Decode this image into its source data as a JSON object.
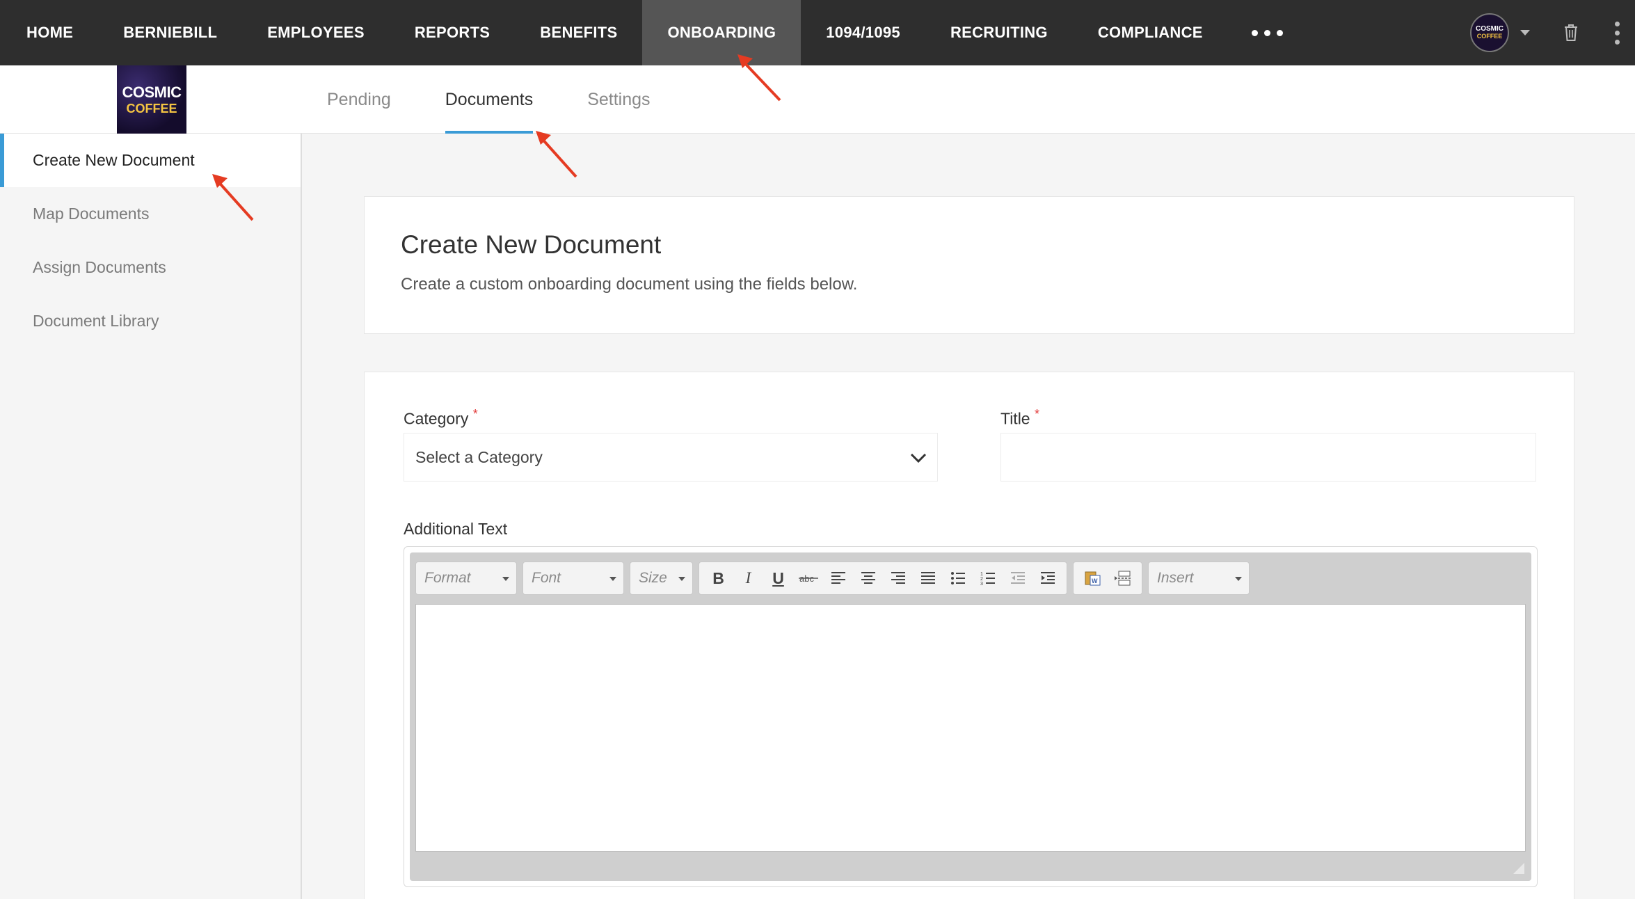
{
  "topnav": {
    "items": [
      "HOME",
      "BERNIEBILL",
      "EMPLOYEES",
      "REPORTS",
      "BENEFITS",
      "ONBOARDING",
      "1094/1095",
      "RECRUITING",
      "COMPLIANCE"
    ],
    "active": "ONBOARDING"
  },
  "logo": {
    "line1": "COSMIC",
    "line2": "COFFEE"
  },
  "subtabs": {
    "items": [
      "Pending",
      "Documents",
      "Settings"
    ],
    "active": "Documents"
  },
  "sidebar": {
    "items": [
      "Create New Document",
      "Map Documents",
      "Assign Documents",
      "Document Library"
    ],
    "active": "Create New Document"
  },
  "intro": {
    "title": "Create New Document",
    "description": "Create a custom onboarding document using the fields below."
  },
  "form": {
    "category_label": "Category",
    "category_placeholder": "Select a Category",
    "title_label": "Title",
    "title_value": "",
    "required_mark": "*",
    "additional_text_label": "Additional Text"
  },
  "editor": {
    "format_label": "Format",
    "font_label": "Font",
    "size_label": "Size",
    "insert_label": "Insert",
    "icons": [
      "bold-icon",
      "italic-icon",
      "underline-icon",
      "strikethrough-icon",
      "align-left-icon",
      "align-center-icon",
      "align-right-icon",
      "align-justify-icon",
      "bulleted-list-icon",
      "numbered-list-icon",
      "outdent-icon",
      "indent-icon",
      "paste-from-word-icon",
      "page-break-icon"
    ]
  },
  "colors": {
    "accent": "#3a9bd6",
    "nav_bg": "#2e2e2e",
    "required": "#e23b3b",
    "annotation": "#e53b22"
  }
}
